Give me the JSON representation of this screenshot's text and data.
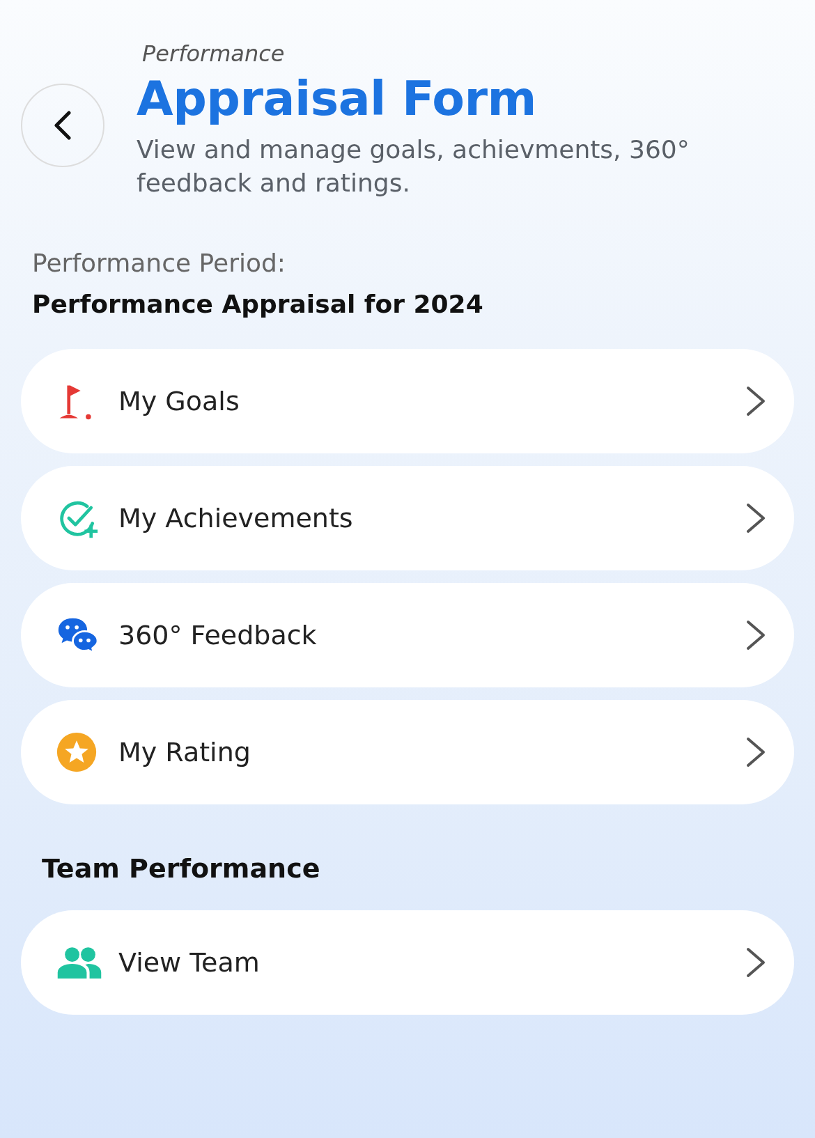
{
  "header": {
    "breadcrumb": "Performance",
    "title": "Appraisal Form",
    "subtitle": "View and manage goals, achievments, 360° feedback and ratings."
  },
  "period": {
    "label": "Performance Period:",
    "value": "Performance Appraisal for 2024"
  },
  "menu": [
    {
      "kind": "goals",
      "label": "My Goals"
    },
    {
      "kind": "achievements",
      "label": "My Achievements"
    },
    {
      "kind": "feedback",
      "label": "360° Feedback"
    },
    {
      "kind": "rating",
      "label": "My Rating"
    }
  ],
  "team_section": {
    "title": "Team Performance",
    "items": [
      {
        "kind": "team",
        "label": "View Team"
      }
    ]
  }
}
